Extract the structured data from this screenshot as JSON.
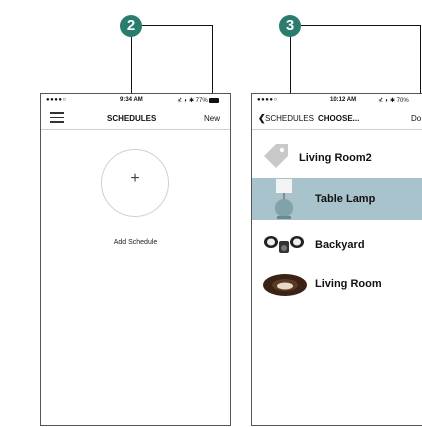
{
  "callouts": [
    "2",
    "3"
  ],
  "phone1": {
    "status": {
      "signal": "●●●●○",
      "time": "9:34 AM",
      "right": "⊀ ◗ ✱ 77%"
    },
    "nav": {
      "title": "SCHEDULES",
      "action": "New"
    },
    "add_plus": "+",
    "add_label": "Add Schedule"
  },
  "phone2": {
    "status": {
      "signal": "●●●●○",
      "time": "10:12 AM",
      "right": "⊀ ◗ ✱ 70%"
    },
    "nav": {
      "back": "SCHEDULES",
      "title": "CHOOSE...",
      "action": "Do"
    },
    "devices": [
      {
        "label": "Living Room2",
        "icon": "tag-icon",
        "selected": false
      },
      {
        "label": "Table Lamp",
        "icon": "lamp-icon",
        "selected": true
      },
      {
        "label": "Backyard",
        "icon": "floodlight-icon",
        "selected": false
      },
      {
        "label": "Living Room",
        "icon": "recessed-light-icon",
        "selected": false
      }
    ]
  },
  "colors": {
    "callout": "#2a7d6d",
    "selected_row": "#a9c3cc"
  }
}
